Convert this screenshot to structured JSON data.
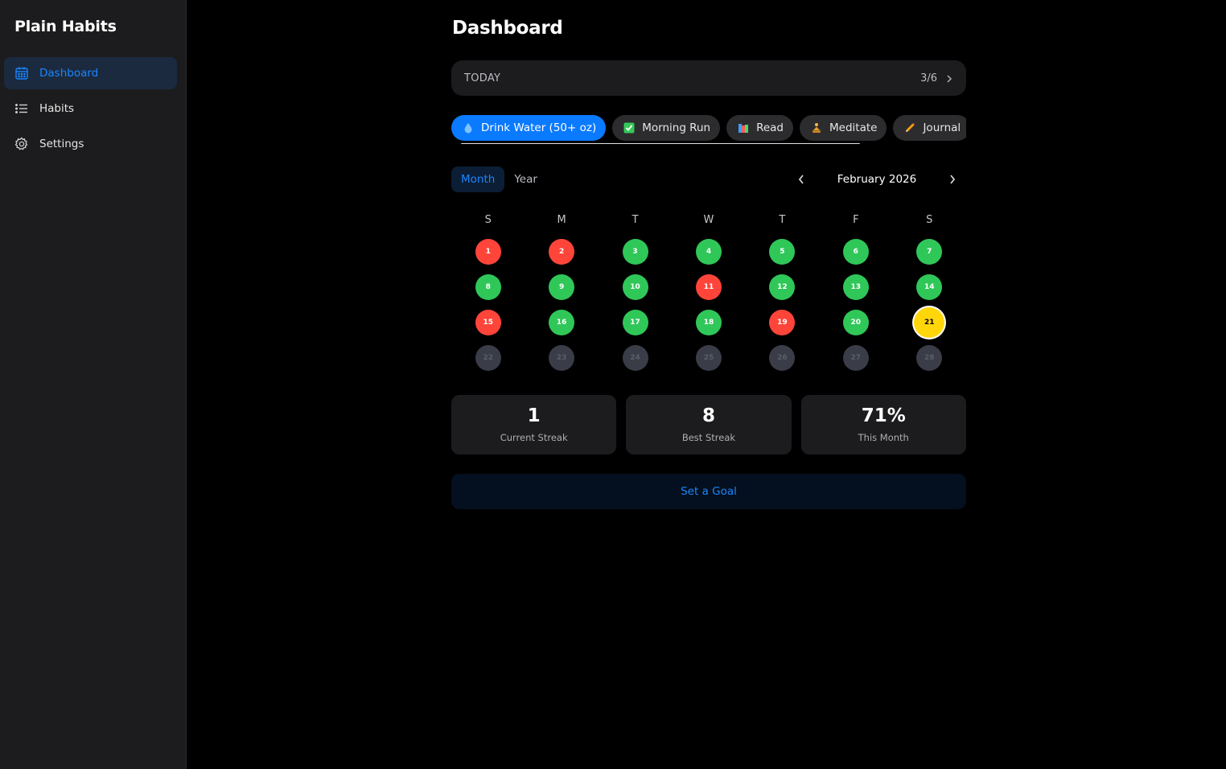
{
  "app": {
    "title": "Plain Habits"
  },
  "sidebar": {
    "items": [
      {
        "label": "Dashboard",
        "icon": "calendar-icon",
        "active": true
      },
      {
        "label": "Habits",
        "icon": "list-icon",
        "active": false
      },
      {
        "label": "Settings",
        "icon": "gear-icon",
        "active": false
      }
    ]
  },
  "main": {
    "title": "Dashboard",
    "today": {
      "label": "TODAY",
      "count": "3/6"
    },
    "habits": [
      {
        "label": "Drink Water (50+ oz)",
        "icon": "water-drop-icon",
        "active": true
      },
      {
        "label": "Morning Run",
        "icon": "checkbox-icon",
        "active": false
      },
      {
        "label": "Read",
        "icon": "books-icon",
        "active": false
      },
      {
        "label": "Meditate",
        "icon": "meditate-icon",
        "active": false
      },
      {
        "label": "Journal",
        "icon": "pencil-icon",
        "active": false
      },
      {
        "label": "",
        "icon": "",
        "active": false
      }
    ],
    "view_toggle": {
      "month": "Month",
      "year": "Year",
      "selected": "month"
    },
    "month_label": "February 2026",
    "weekdays": [
      "S",
      "M",
      "T",
      "W",
      "T",
      "F",
      "S"
    ],
    "days": [
      {
        "n": "1",
        "s": "missed"
      },
      {
        "n": "2",
        "s": "missed"
      },
      {
        "n": "3",
        "s": "done"
      },
      {
        "n": "4",
        "s": "done"
      },
      {
        "n": "5",
        "s": "done"
      },
      {
        "n": "6",
        "s": "done"
      },
      {
        "n": "7",
        "s": "done"
      },
      {
        "n": "8",
        "s": "done"
      },
      {
        "n": "9",
        "s": "done"
      },
      {
        "n": "10",
        "s": "done"
      },
      {
        "n": "11",
        "s": "missed"
      },
      {
        "n": "12",
        "s": "done"
      },
      {
        "n": "13",
        "s": "done"
      },
      {
        "n": "14",
        "s": "done"
      },
      {
        "n": "15",
        "s": "missed"
      },
      {
        "n": "16",
        "s": "done"
      },
      {
        "n": "17",
        "s": "done"
      },
      {
        "n": "18",
        "s": "done"
      },
      {
        "n": "19",
        "s": "missed"
      },
      {
        "n": "20",
        "s": "done"
      },
      {
        "n": "21",
        "s": "today"
      },
      {
        "n": "22",
        "s": "future"
      },
      {
        "n": "23",
        "s": "future"
      },
      {
        "n": "24",
        "s": "future"
      },
      {
        "n": "25",
        "s": "future"
      },
      {
        "n": "26",
        "s": "future"
      },
      {
        "n": "27",
        "s": "future"
      },
      {
        "n": "28",
        "s": "future"
      }
    ],
    "stats": [
      {
        "value": "1",
        "label": "Current Streak"
      },
      {
        "value": "8",
        "label": "Best Streak"
      },
      {
        "value": "71%",
        "label": "This Month"
      }
    ],
    "goal_button": "Set a Goal"
  },
  "colors": {
    "accent": "#0a7aff",
    "done": "#30c759",
    "missed": "#ff453a",
    "today": "#ffd60a",
    "future": "#3a3d48"
  }
}
